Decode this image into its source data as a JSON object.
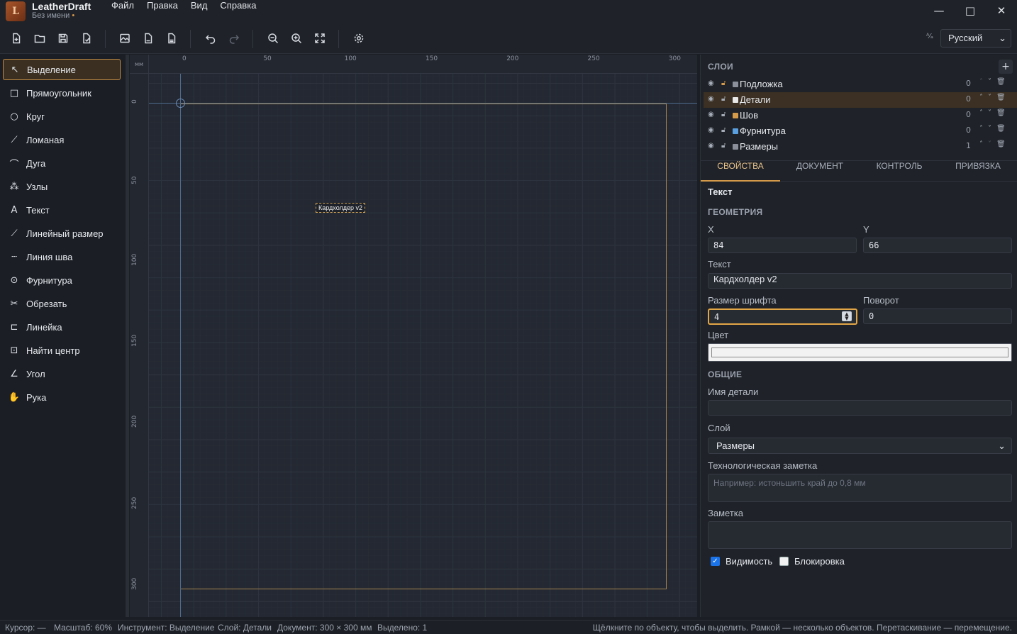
{
  "app": {
    "name": "LeatherDraft",
    "document": "Без имени",
    "dirty_marker": "•",
    "logo_letter": "L"
  },
  "menu": [
    "Файл",
    "Правка",
    "Вид",
    "Справка"
  ],
  "window_controls": {
    "minimize": "—",
    "maximize": "□",
    "close": "✕"
  },
  "toolbar": {
    "icons": [
      "new-file-icon",
      "open-folder-icon",
      "save-icon",
      "save-as-icon",
      "export-image-icon",
      "export-pdf-icon",
      "export-svg-icon",
      "undo-icon",
      "redo-icon",
      "zoom-out-icon",
      "zoom-in-icon",
      "fit-view-icon",
      "settings-icon"
    ],
    "language": {
      "icon": "translate-icon",
      "value": "Русский"
    }
  },
  "tools": [
    {
      "label": "Выделение",
      "icon": "cursor-icon",
      "glyph": "↖",
      "active": true
    },
    {
      "label": "Прямоугольник",
      "icon": "rectangle-icon",
      "glyph": "□"
    },
    {
      "label": "Круг",
      "icon": "circle-icon",
      "glyph": "○"
    },
    {
      "label": "Ломаная",
      "icon": "polyline-icon",
      "glyph": "⟋"
    },
    {
      "label": "Дуга",
      "icon": "arc-icon",
      "glyph": "⌒"
    },
    {
      "label": "Узлы",
      "icon": "nodes-icon",
      "glyph": "⁂"
    },
    {
      "label": "Текст",
      "icon": "text-icon",
      "glyph": "A"
    },
    {
      "label": "Линейный размер",
      "icon": "dimension-icon",
      "glyph": "⟋"
    },
    {
      "label": "Линия шва",
      "icon": "seam-line-icon",
      "glyph": "┄"
    },
    {
      "label": "Фурнитура",
      "icon": "hardware-icon",
      "glyph": "⊙"
    },
    {
      "label": "Обрезать",
      "icon": "scissors-icon",
      "glyph": "✂"
    },
    {
      "label": "Линейка",
      "icon": "ruler-icon",
      "glyph": "⊏"
    },
    {
      "label": "Найти центр",
      "icon": "find-center-icon",
      "glyph": "⊡"
    },
    {
      "label": "Угол",
      "icon": "angle-icon",
      "glyph": "∠"
    },
    {
      "label": "Рука",
      "icon": "hand-icon",
      "glyph": "✋"
    }
  ],
  "canvas": {
    "units": "мм",
    "top_ticks": [
      "0",
      "50",
      "100",
      "150",
      "200",
      "250",
      "300"
    ],
    "left_ticks": [
      "0",
      "50",
      "100",
      "150",
      "200",
      "250",
      "300"
    ],
    "text_object": "Кардхолдер v2"
  },
  "layers": {
    "title": "СЛОИ",
    "add": "+",
    "items": [
      {
        "name": "Подложка",
        "count": "0",
        "color": "#8a8f99",
        "locked": true
      },
      {
        "name": "Детали",
        "count": "0",
        "color": "#e8e8e8",
        "selected": true
      },
      {
        "name": "Шов",
        "count": "0",
        "color": "#d59a4a"
      },
      {
        "name": "Фурнитура",
        "count": "0",
        "color": "#5aa0e0"
      },
      {
        "name": "Размеры",
        "count": "1",
        "color": "#8a8f99"
      }
    ]
  },
  "tabs": [
    "СВОЙСТВА",
    "ДОКУМЕНТ",
    "КОНТРОЛЬ",
    "ПРИВЯЗКА"
  ],
  "properties": {
    "object_type": "Текст",
    "geometry_title": "ГЕОМЕТРИЯ",
    "x_label": "X",
    "x_value": "84",
    "y_label": "Y",
    "y_value": "66",
    "text_label": "Текст",
    "text_value": "Кардхолдер v2",
    "font_size_label": "Размер шрифта",
    "font_size_value": "4",
    "rotation_label": "Поворот",
    "rotation_value": "0",
    "color_label": "Цвет",
    "color_value": "#f2f2f2",
    "general_title": "ОБЩИЕ",
    "part_name_label": "Имя детали",
    "part_name_value": "",
    "layer_label": "Слой",
    "layer_value": "Размеры",
    "tech_note_label": "Технологическая заметка",
    "tech_note_placeholder": "Например: истоньшить край до 0,8 мм",
    "note_label": "Заметка",
    "visibility_label": "Видимость",
    "visibility_checked": true,
    "lock_label": "Блокировка",
    "lock_checked": false
  },
  "status": {
    "cursor": "Курсор: —",
    "zoom": "Масштаб: 60%",
    "tool": "Инструмент: Выделение",
    "layer": "Слой: Детали",
    "document": "Документ: 300 × 300 мм",
    "selected": "Выделено: 1",
    "hint": "Щёлкните по объекту, чтобы выделить. Рамкой — несколько объектов. Перетаскивание — перемещение."
  }
}
